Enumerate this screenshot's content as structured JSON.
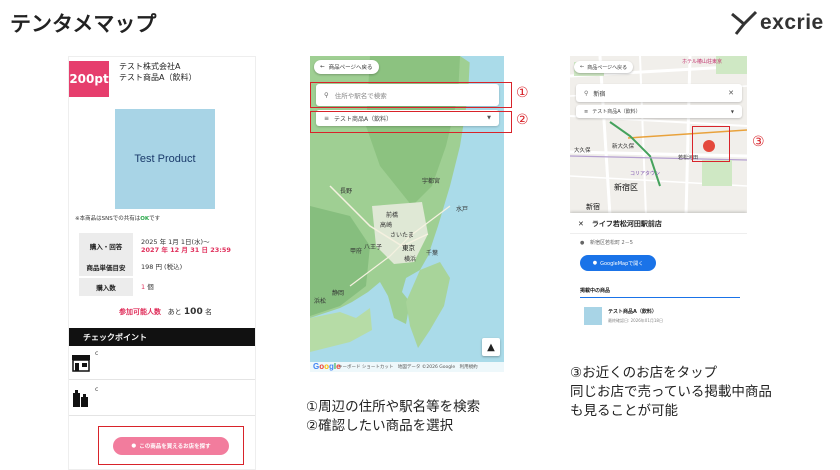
{
  "header": {
    "title": "テンタメマップ",
    "logo_text": "excrie"
  },
  "panel1": {
    "points": "200pt",
    "company": "テスト株式会社A",
    "product": "テスト商品A（飲料）",
    "image_text": "Test Product",
    "sns_note_prefix": "※本商品はSNSでの共有は",
    "sns_note_ok": "OK",
    "sns_note_suffix": "です",
    "rows": [
      {
        "label": "購入・回答",
        "value": "2025 年 1月 1日(水)〜",
        "value2": "2027 年 12 月 31 日 23:59"
      },
      {
        "label": "商品単価目安",
        "value": "198 円 (税込)"
      },
      {
        "label": "購入数",
        "value": "1",
        "unit": "個"
      }
    ],
    "remain_label": "参加可能人数",
    "remain_prefix": "あと",
    "remain_num": "100",
    "remain_unit": "名",
    "checkpoint_title": "チェックポイント",
    "checkpoint_items": [
      "c",
      "c"
    ],
    "store_button": "この商品を買えるお店を探す"
  },
  "panel2": {
    "back_label": "商品ページへ戻る",
    "search_placeholder": "住所や駅名で検索",
    "select_value": "テスト商品A（飲料）",
    "marker1": "①",
    "marker2": "②",
    "cities": [
      {
        "name": "宇都宮"
      },
      {
        "name": "前橋"
      },
      {
        "name": "高崎"
      },
      {
        "name": "水戸"
      },
      {
        "name": "さいたま"
      },
      {
        "name": "東京"
      },
      {
        "name": "横浜"
      },
      {
        "name": "千葉"
      },
      {
        "name": "静岡"
      },
      {
        "name": "浜松"
      },
      {
        "name": "長野"
      },
      {
        "name": "甲府"
      },
      {
        "name": "八王子"
      }
    ],
    "footer": "キーボード ショートカット　地図データ ©2026 Google　利用規約",
    "google": "Google"
  },
  "panel3": {
    "back_label": "商品ページへ戻る",
    "search_value": "新宿",
    "select_value": "テスト商品A（飲料）",
    "marker": "③",
    "map_labels": [
      {
        "name": "ホテル椿山荘東京"
      },
      {
        "name": "新大久保"
      },
      {
        "name": "大久保"
      },
      {
        "name": "若松河田"
      },
      {
        "name": "新宿区"
      },
      {
        "name": "コリアタウン"
      },
      {
        "name": "新宿"
      }
    ],
    "store_name": "ライフ若松河田駅前店",
    "store_address": "新宿区若松町 2－5",
    "gmap_button": "GoogleMapで開く",
    "listed_heading": "掲載中の商品",
    "listed_product": "テスト商品A（飲料）",
    "listed_meta": "最終確認日: 2026年01月18日"
  },
  "captions": {
    "c2_line1": "①周辺の住所や駅名等を検索",
    "c2_line2": "②確認したい商品を選択",
    "c3_line1": "③お近くのお店をタップ",
    "c3_line2": "同じお店で売っている掲載中商品",
    "c3_line3": "も見ることが可能"
  },
  "colors": {
    "accent_pink": "#e63e6d",
    "button_pink": "#f27c9d",
    "highlight_red": "#d8232a",
    "gmap_blue": "#1a73e8"
  }
}
